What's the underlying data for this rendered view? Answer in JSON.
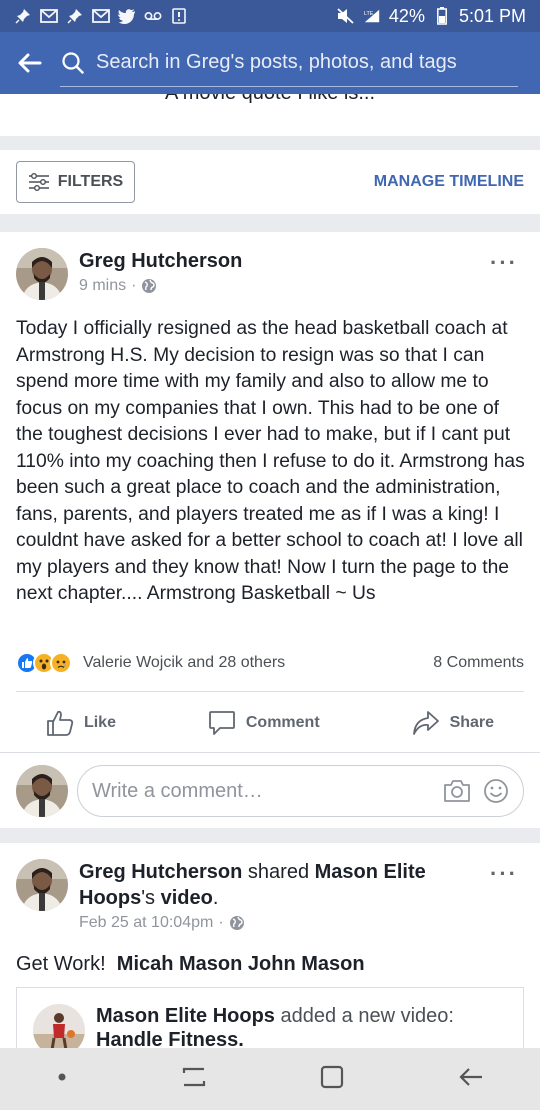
{
  "status_bar": {
    "battery": "42%",
    "time": "5:01 PM",
    "network": "LTE"
  },
  "header": {
    "search_placeholder": "Search in Greg's posts, photos, and tags"
  },
  "profile": {
    "quote_prompt": "A movie quote I like is..."
  },
  "timeline_controls": {
    "filters_label": "FILTERS",
    "manage_label": "MANAGE TIMELINE"
  },
  "post1": {
    "author": "Greg Hutcherson",
    "time": "9 mins",
    "privacy_icon": "globe-icon",
    "text": "Today I officially resigned as the head basketball coach at Armstrong H.S. My decision to resign was so that I can spend more time with my family and also to allow me to focus on my companies that I own. This had to be one of the toughest decisions I ever had to make, but if I cant put 110% into my coaching then I refuse to do it. Armstrong has been such a great place to coach and the administration, fans, parents, and players treated me as if I was a king! I couldnt have asked for a better school to coach at! I love all my players and they know that! Now I turn the page to the next chapter.... Armstrong Basketball ~ Us",
    "reactions_text": "Valerie Wojcik and 28 others",
    "comments_count": "8 Comments",
    "like_label": "Like",
    "comment_label": "Comment",
    "share_label": "Share",
    "comment_placeholder": "Write a comment…"
  },
  "post2": {
    "author": "Greg Hutcherson",
    "shared_word": "shared",
    "page_name": "Mason Elite Hoops",
    "possessive": "'s",
    "video_word": "video",
    "period": ".",
    "time": "Feb 25 at 10:04pm",
    "text_prefix": "Get Work!",
    "tag1": "Micah Mason",
    "tag2": "John Mason",
    "shared_author": "Mason Elite Hoops",
    "shared_action": "added a new video:",
    "shared_title": "Handle Fitness."
  },
  "colors": {
    "brand_blue": "#4267b2",
    "status_blue": "#3b5998",
    "text": "#1d2129",
    "muted": "#90949c"
  }
}
